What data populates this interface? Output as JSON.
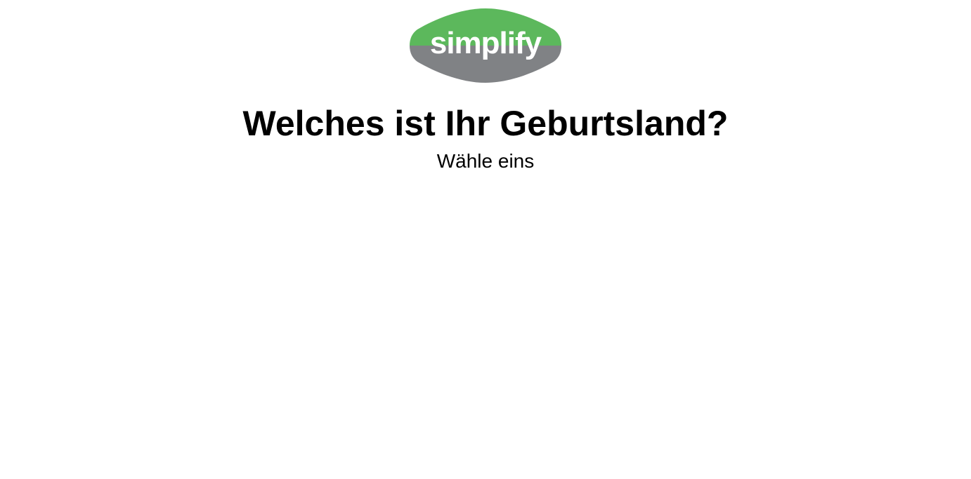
{
  "logo": {
    "text": "simplify",
    "colors": {
      "top": "#5cb85c",
      "bottom": "#808285",
      "text": "#ffffff"
    }
  },
  "question": {
    "title": "Welches ist Ihr Geburtsland?",
    "subtitle": "Wähle eins"
  }
}
